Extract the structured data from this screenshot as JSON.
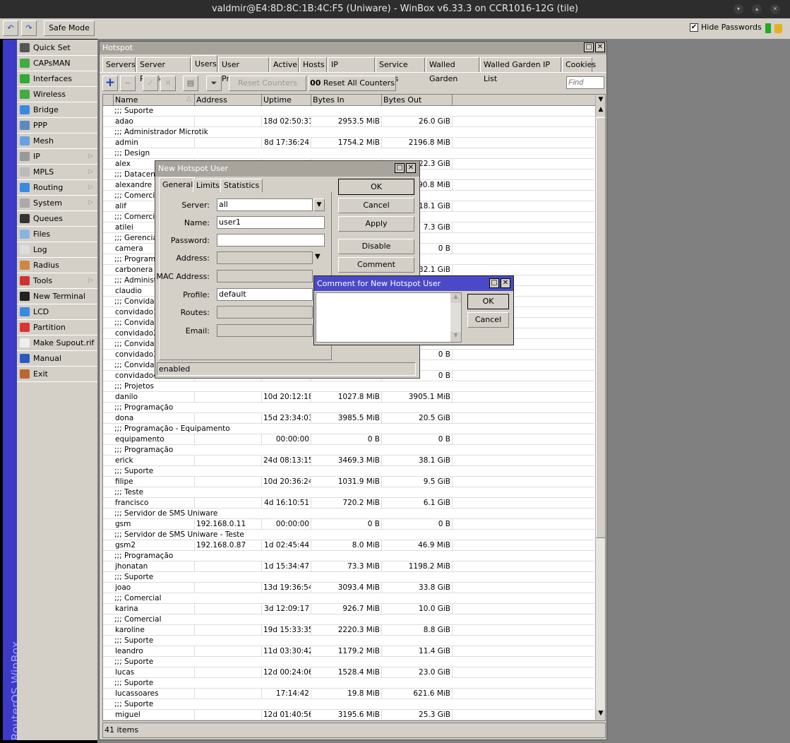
{
  "window": {
    "title": "valdmir@E4:8D:8C:1B:4C:F5 (Uniware) - WinBox v6.33.3 on CCR1016-12G (tile)"
  },
  "topbar": {
    "undo": "↶",
    "redo": "↷",
    "safe_mode": "Safe Mode",
    "hide_passwords": "Hide Passwords",
    "hide_passwords_checked": true
  },
  "brand": "RouterOS WinBox",
  "menu": [
    {
      "label": "Quick Set",
      "icon": "wand-icon",
      "color": "#555"
    },
    {
      "label": "CAPsMAN",
      "icon": "antenna-icon",
      "color": "#4a4"
    },
    {
      "label": "Interfaces",
      "icon": "nic-icon",
      "color": "#3a3"
    },
    {
      "label": "Wireless",
      "icon": "antenna-icon",
      "color": "#4a4"
    },
    {
      "label": "Bridge",
      "icon": "bridge-icon",
      "color": "#3a8ae0"
    },
    {
      "label": "PPP",
      "icon": "ppp-icon",
      "color": "#5a8ac0"
    },
    {
      "label": "Mesh",
      "icon": "mesh-icon",
      "color": "#6aa0e0"
    },
    {
      "label": "IP",
      "icon": "ip-icon",
      "color": "#999",
      "sub": true
    },
    {
      "label": "MPLS",
      "icon": "mpls-icon",
      "color": "#bbb",
      "sub": true
    },
    {
      "label": "Routing",
      "icon": "routing-icon",
      "color": "#3a8ae0",
      "sub": true
    },
    {
      "label": "System",
      "icon": "gear-icon",
      "color": "#aaa",
      "sub": true
    },
    {
      "label": "Queues",
      "icon": "gauge-icon",
      "color": "#333"
    },
    {
      "label": "Files",
      "icon": "folder-icon",
      "color": "#8ab4e0"
    },
    {
      "label": "Log",
      "icon": "log-icon",
      "color": "#ddd"
    },
    {
      "label": "Radius",
      "icon": "users-icon",
      "color": "#c84"
    },
    {
      "label": "Tools",
      "icon": "tools-icon",
      "color": "#c33",
      "sub": true
    },
    {
      "label": "New Terminal",
      "icon": "terminal-icon",
      "color": "#222"
    },
    {
      "label": "LCD",
      "icon": "monitor-icon",
      "color": "#3a8ae0"
    },
    {
      "label": "Partition",
      "icon": "pie-icon",
      "color": "#d33"
    },
    {
      "label": "Make Supout.rif",
      "icon": "file-icon",
      "color": "#eee"
    },
    {
      "label": "Manual",
      "icon": "help-icon",
      "color": "#2a5ac0"
    },
    {
      "label": "Exit",
      "icon": "door-icon",
      "color": "#b63"
    }
  ],
  "hotspot": {
    "title": "Hotspot",
    "tabs": [
      "Servers",
      "Server Profiles",
      "Users",
      "User Profiles",
      "Active",
      "Hosts",
      "IP Bindings",
      "Service Ports",
      "Walled Garden",
      "Walled Garden IP List",
      "Cookies"
    ],
    "active_tab": "Users",
    "toolbar": {
      "reset_counters": "Reset Counters",
      "reset_all_counters": "Reset All Counters",
      "reset_all_prefix": "00",
      "find_placeholder": "Find"
    },
    "columns": [
      "Name",
      "Address",
      "Uptime",
      "Bytes In",
      "Bytes Out"
    ],
    "rows": [
      {
        "comment": ";;; Suporte",
        "name": "adao",
        "address": "",
        "uptime": "18d 02:50:31",
        "in": "2953.5 MiB",
        "out": "26.0 GiB"
      },
      {
        "comment": ";;; Administrador Microtik",
        "name": "admin",
        "address": "",
        "uptime": "8d 17:36:24",
        "in": "1754.2 MiB",
        "out": "2196.8 MiB"
      },
      {
        "comment": ";;; Design",
        "name": "alex",
        "address": "",
        "uptime": "",
        "in": "",
        "out": "22.3 GiB"
      },
      {
        "comment": ";;; Datacent",
        "name": "alexandre",
        "address": "",
        "uptime": "",
        "in": "",
        "out": "90.8 MiB"
      },
      {
        "comment": ";;; Comercia",
        "name": "alif",
        "address": "",
        "uptime": "",
        "in": "",
        "out": "18.1 GiB"
      },
      {
        "comment": ";;; Comercia",
        "name": "atilei",
        "address": "",
        "uptime": "",
        "in": "",
        "out": "7.3 GiB"
      },
      {
        "comment": ";;; Gerenciar",
        "name": "camera",
        "address": "",
        "uptime": "",
        "in": "",
        "out": "0 B"
      },
      {
        "comment": ";;; Programa",
        "name": "carbonera",
        "address": "",
        "uptime": "",
        "in": "",
        "out": "32.1 GiB"
      },
      {
        "comment": ";;; Administr",
        "name": "claudio",
        "address": "",
        "uptime": "",
        "in": "",
        "out": ""
      },
      {
        "comment": ";;; Convidad",
        "name": "convidado1",
        "address": "",
        "uptime": "",
        "in": "",
        "out": ""
      },
      {
        "comment": ";;; Convidad",
        "name": "convidado2",
        "address": "",
        "uptime": "",
        "in": "",
        "out": ""
      },
      {
        "comment": ";;; Convidad",
        "name": "convidado3",
        "address": "",
        "uptime": "",
        "in": "",
        "out": "0 B"
      },
      {
        "comment": ";;; Convidad",
        "name": "convidado4",
        "address": "",
        "uptime": "",
        "in": "",
        "out": "0 B"
      },
      {
        "comment": ";;; Projetos",
        "name": "danilo",
        "address": "",
        "uptime": "10d 20:12:18",
        "in": "1027.8 MiB",
        "out": "3905.1 MiB"
      },
      {
        "comment": ";;; Programação",
        "name": "dona",
        "address": "",
        "uptime": "15d 23:34:03",
        "in": "3985.5 MiB",
        "out": "20.5 GiB"
      },
      {
        "comment": ";;; Programação - Equipamento",
        "name": "equipamento",
        "address": "",
        "uptime": "00:00:00",
        "in": "0 B",
        "out": "0 B"
      },
      {
        "comment": ";;; Programação",
        "name": "erick",
        "address": "",
        "uptime": "24d 08:13:15",
        "in": "3469.3 MiB",
        "out": "38.1 GiB"
      },
      {
        "comment": ";;; Suporte",
        "name": "filipe",
        "address": "",
        "uptime": "10d 20:36:24",
        "in": "1031.9 MiB",
        "out": "9.5 GiB"
      },
      {
        "comment": ";;; Teste",
        "name": "francisco",
        "address": "",
        "uptime": "4d 16:10:51",
        "in": "720.2 MiB",
        "out": "6.1 GiB"
      },
      {
        "comment": ";;; Servidor de SMS Uniware",
        "name": "gsm",
        "address": "192.168.0.11",
        "uptime": "00:00:00",
        "in": "0 B",
        "out": "0 B"
      },
      {
        "comment": ";;; Servidor de SMS Uniware - Teste",
        "name": "gsm2",
        "address": "192.168.0.87",
        "uptime": "1d 02:45:44",
        "in": "8.0 MiB",
        "out": "46.9 MiB"
      },
      {
        "comment": ";;; Programação",
        "name": "jhonatan",
        "address": "",
        "uptime": "1d 15:34:47",
        "in": "73.3 MiB",
        "out": "1198.2 MiB"
      },
      {
        "comment": ";;; Suporte",
        "name": "joao",
        "address": "",
        "uptime": "13d 19:36:54",
        "in": "3093.4 MiB",
        "out": "33.8 GiB"
      },
      {
        "comment": ";;; Comercial",
        "name": "karina",
        "address": "",
        "uptime": "3d 12:09:17",
        "in": "926.7 MiB",
        "out": "10.0 GiB"
      },
      {
        "comment": ";;; Comercial",
        "name": "karoline",
        "address": "",
        "uptime": "19d 15:33:35",
        "in": "2220.3 MiB",
        "out": "8.8 GiB"
      },
      {
        "comment": ";;; Suporte",
        "name": "leandro",
        "address": "",
        "uptime": "11d 03:30:42",
        "in": "1179.2 MiB",
        "out": "11.4 GiB"
      },
      {
        "comment": ";;; Suporte",
        "name": "lucas",
        "address": "",
        "uptime": "12d 00:24:06",
        "in": "1528.4 MiB",
        "out": "23.0 GiB"
      },
      {
        "comment": ";;; Suporte",
        "name": "lucassoares",
        "address": "",
        "uptime": "17:14:42",
        "in": "19.8 MiB",
        "out": "621.6 MiB"
      },
      {
        "comment": ";;; Suporte",
        "name": "miguel",
        "address": "",
        "uptime": "12d 01:40:56",
        "in": "3195.6 MiB",
        "out": "25.3 GiB"
      }
    ],
    "status": "41 items"
  },
  "new_user": {
    "title": "New Hotspot User",
    "tabs": [
      "General",
      "Limits",
      "Statistics"
    ],
    "fields": {
      "server_label": "Server:",
      "server": "all",
      "name_label": "Name:",
      "name": "user1",
      "password_label": "Password:",
      "password": "",
      "address_label": "Address:",
      "mac_label": "MAC Address:",
      "profile_label": "Profile:",
      "profile": "default",
      "routes_label": "Routes:",
      "email_label": "Email:"
    },
    "buttons": [
      "OK",
      "Cancel",
      "Apply",
      "Disable",
      "Comment"
    ],
    "status": "enabled"
  },
  "comment_dialog": {
    "title": "Comment for New Hotspot User",
    "text": "",
    "ok": "OK",
    "cancel": "Cancel"
  }
}
